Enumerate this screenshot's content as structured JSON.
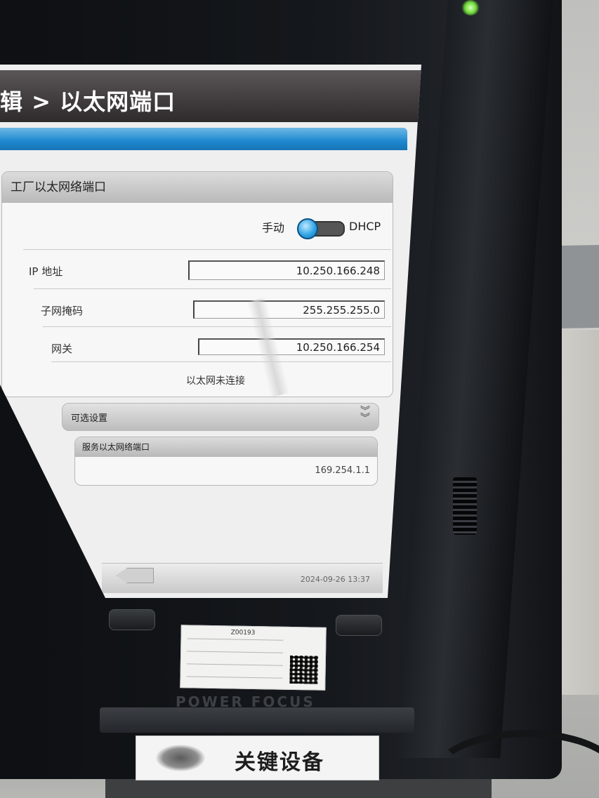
{
  "screen": {
    "title": "辑 > 以太网端口",
    "factory_panel": {
      "heading": "工厂以太网络端口",
      "mode_left": "手动",
      "mode_right": "DHCP",
      "fields": [
        {
          "label": "IP 地址",
          "value": "10.250.166.248"
        },
        {
          "label": "子网掩码",
          "value": "255.255.255.0"
        },
        {
          "label": "网关",
          "value": "10.250.166.254"
        }
      ],
      "status": "以太网未连接"
    },
    "optional_settings": {
      "label": "可选设置",
      "icon": "double-chevron-down-icon"
    },
    "service_panel": {
      "heading": "服务以太网络端口",
      "value": "169.254.1.1"
    },
    "footer": {
      "back_icon": "back-arrow-icon",
      "datetime": "2024-09-26 13:37"
    }
  },
  "device": {
    "brand": "POWER FOCUS",
    "sticker_text": "Z00193",
    "label_text": "关键设备"
  },
  "colors": {
    "title_bar": "#2e2b2d",
    "accent_blue": "#1e88cf",
    "screen_bg": "#efefef",
    "led_green": "#6fdc3a"
  }
}
